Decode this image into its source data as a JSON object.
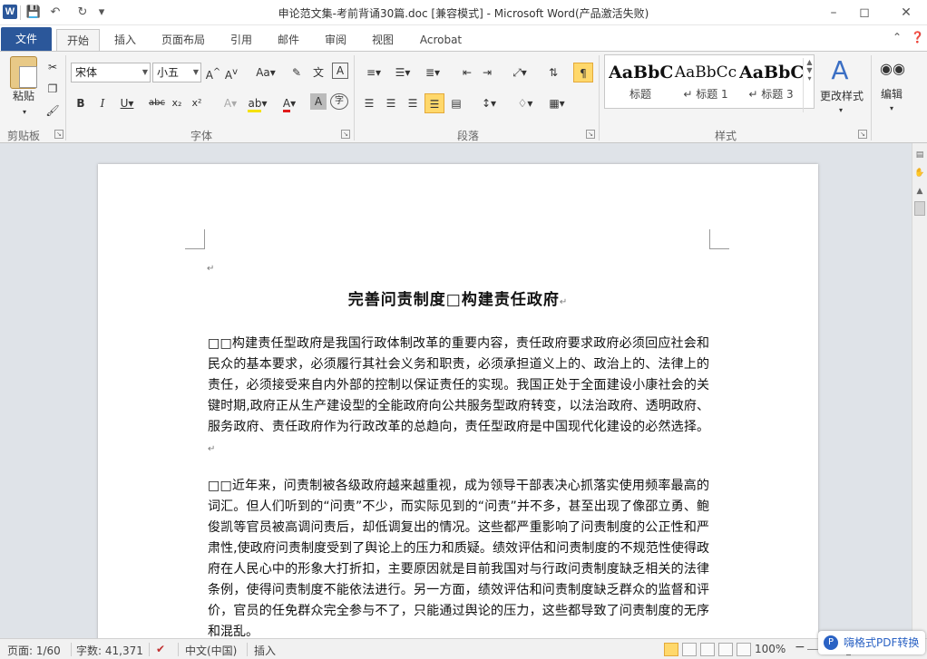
{
  "window": {
    "title": "申论范文集-考前背诵30篇.doc [兼容模式] - Microsoft Word(产品激活失败)",
    "app_icon": "W"
  },
  "qat": {
    "save": "💾",
    "undo": "↶",
    "redo": "↻",
    "more": "▾"
  },
  "tabs": [
    "文件",
    "开始",
    "插入",
    "页面布局",
    "引用",
    "邮件",
    "审阅",
    "视图",
    "Acrobat"
  ],
  "ribbon": {
    "clipboard": {
      "paste_label": "粘贴",
      "group_label": "剪贴板"
    },
    "font": {
      "font_name": "宋体",
      "font_size": "小五",
      "group_label": "字体"
    },
    "paragraph": {
      "group_label": "段落"
    },
    "styles": {
      "items": [
        {
          "sample": "AaBbC",
          "name": "标题"
        },
        {
          "sample": "AaBbCc",
          "name": "↵ 标题 1"
        },
        {
          "sample": "AaBbC",
          "name": "↵ 标题 3"
        }
      ],
      "change_styles": "更改样式",
      "group_label": "样式"
    },
    "editing": {
      "label": "编辑"
    }
  },
  "document": {
    "title": "完善问责制度□构建责任政府",
    "paragraphs": [
      "□□构建责任型政府是我国行政体制改革的重要内容，责任政府要求政府必须回应社会和民众的基本要求，必须履行其社会义务和职责，必须承担道义上的、政治上的、法律上的责任，必须接受来自内外部的控制以保证责任的实现。我国正处于全面建设小康社会的关键时期,政府正从生产建设型的全能政府向公共服务型政府转变，以法治政府、透明政府、服务政府、责任政府作为行政改革的总趋向，责任型政府是中国现代化建设的必然选择。",
      "□□近年来，问责制被各级政府越来越重视，成为领导干部表决心抓落实使用频率最高的词汇。但人们听到的“问责”不少，而实际见到的“问责”并不多，甚至出现了像邵立勇、鲍俊凯等官员被高调问责后，却低调复出的情况。这些都严重影响了问责制度的公正性和严肃性,使政府问责制度受到了舆论上的压力和质疑。绩效评估和问责制度的不规范性使得政府在人民心中的形象大打折扣，主要原因就是目前我国对与行政问责制度缺乏相关的法律条例，使得问责制度不能依法进行。另一方面，绩效评估和问责制度缺乏群众的监督和评价，官员的任免群众完全参与不了，只能通过舆论的压力，这些都导致了问责制度的无序和混乱。"
    ],
    "paragraph_mark": "↵"
  },
  "status": {
    "page": "页面: 1/60",
    "words": "字数: 41,371",
    "language": "中文(中国)",
    "mode": "插入",
    "zoom": "100%",
    "zoom_minus": "−",
    "zoom_plus": "+"
  },
  "watermark": {
    "text": "嗨格式PDF转换器",
    "icon": "P"
  }
}
